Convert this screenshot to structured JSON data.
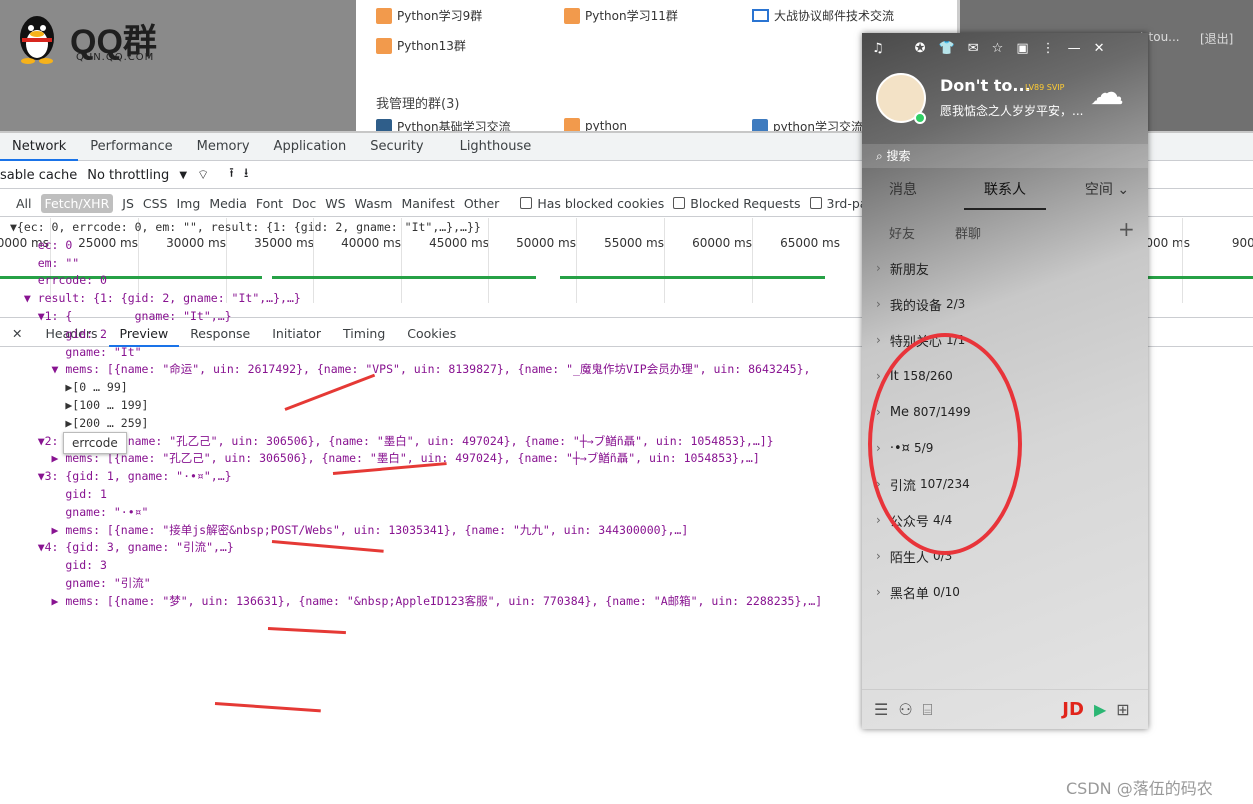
{
  "header": {
    "logo_text": "QQ群",
    "logo_sub": "QUN.QQ.COM",
    "right_link1": "t tou...",
    "right_link2": "[退出]"
  },
  "groups": {
    "row1": [
      "Python学习9群",
      "Python学习11群",
      "大战协议邮件技术交流"
    ],
    "row2": [
      "Python13群"
    ],
    "managed_title": "我管理的群(3)",
    "managed": [
      "Python基础学习交流",
      "python",
      "python学习交流"
    ]
  },
  "devtools": {
    "tabs": [
      "Network",
      "Performance",
      "Memory",
      "Application",
      "Security",
      "Lighthouse"
    ],
    "toolbar": {
      "disable_cache": "sable cache",
      "throttle": "No throttling"
    },
    "filters": [
      "All",
      "Fetch/XHR",
      "JS",
      "CSS",
      "Img",
      "Media",
      "Font",
      "Doc",
      "WS",
      "Wasm",
      "Manifest",
      "Other"
    ],
    "checkboxes": [
      "Has blocked cookies",
      "Blocked Requests",
      "3rd-par"
    ],
    "ticks": [
      "0000 ms",
      "25000 ms",
      "30000 ms",
      "35000 ms",
      "40000 ms",
      "45000 ms",
      "50000 ms",
      "55000 ms",
      "60000 ms",
      "65000 ms",
      "000 ms",
      "90000"
    ],
    "detail_tabs": [
      "Headers",
      "Preview",
      "Response",
      "Initiator",
      "Timing",
      "Cookies"
    ],
    "tooltip": "errcode"
  },
  "json_lines": [
    "▼{ec: 0, errcode: 0, em: \"\", result: {1: {gid: 2, gname: \"It\",…},…}}",
    "    ec: 0",
    "    em: \"\"",
    "    errcode: 0",
    "  ▼ result: {1: {gid: 2, gname: \"It\",…},…}",
    "    ▼1: {         gname: \"It\",…}",
    "        gid: 2",
    "        gname: \"It\"",
    "      ▼ mems: [{name: \"命运\", uin: 2617492}, {name: \"VPS\", uin: 8139827}, {name: \"_魔鬼作坊VIP会员办理\", uin: 8643245},",
    "        ▶[0 … 99]",
    "        ▶[100 … 199]",
    "        ▶[200 … 259]",
    "    ▼2: {mems: [{name: \"孔乙己\", uin: 306506}, {name: \"墨白\", uin: 497024}, {name: \"┼→ブ鰌ñ聶\", uin: 1054853},…]}",
    "      ▶ mems: [{name: \"孔乙己\", uin: 306506}, {name: \"墨白\", uin: 497024}, {name: \"┼→ブ鰌ñ聶\", uin: 1054853},…]",
    "    ▼3: {gid: 1, gname: \"·•¤\",…}",
    "        gid: 1",
    "        gname: \"·•¤\"",
    "      ▶ mems: [{name: \"接单js解密&nbsp;POST/Webs\", uin: 13035341}, {name: \"九九\", uin: 344300000},…]",
    "    ▼4: {gid: 3, gname: \"引流\",…}",
    "        gid: 3",
    "        gname: \"引流\"",
    "      ▶ mems: [{name: \"梦\", uin: 136631}, {name: \"&nbsp;AppleID123客服\", uin: 770384}, {name: \"A邮箱\", uin: 2288235},…]"
  ],
  "qq": {
    "nick": "Don't to...",
    "vip": "LV89 SVIP",
    "sign": "愿我惦念之人岁岁平安，...",
    "search": "搜索",
    "tabs": [
      "消息",
      "联系人",
      "空间 ⌄"
    ],
    "subtabs": [
      "好友",
      "群聊"
    ],
    "groups": [
      {
        "name": "新朋友",
        "count": ""
      },
      {
        "name": "我的设备",
        "count": "2/3"
      },
      {
        "name": "特别关心",
        "count": "1/1"
      },
      {
        "name": "It",
        "count": "158/260"
      },
      {
        "name": "Me",
        "count": "807/1499"
      },
      {
        "name": "·•¤",
        "count": "5/9"
      },
      {
        "name": "引流",
        "count": "107/234"
      },
      {
        "name": "公众号",
        "count": "4/4"
      },
      {
        "name": "陌生人",
        "count": "0/3"
      },
      {
        "name": "黑名单",
        "count": "0/10"
      }
    ],
    "brand": "JD"
  },
  "watermark": "CSDN @落伍的码农"
}
